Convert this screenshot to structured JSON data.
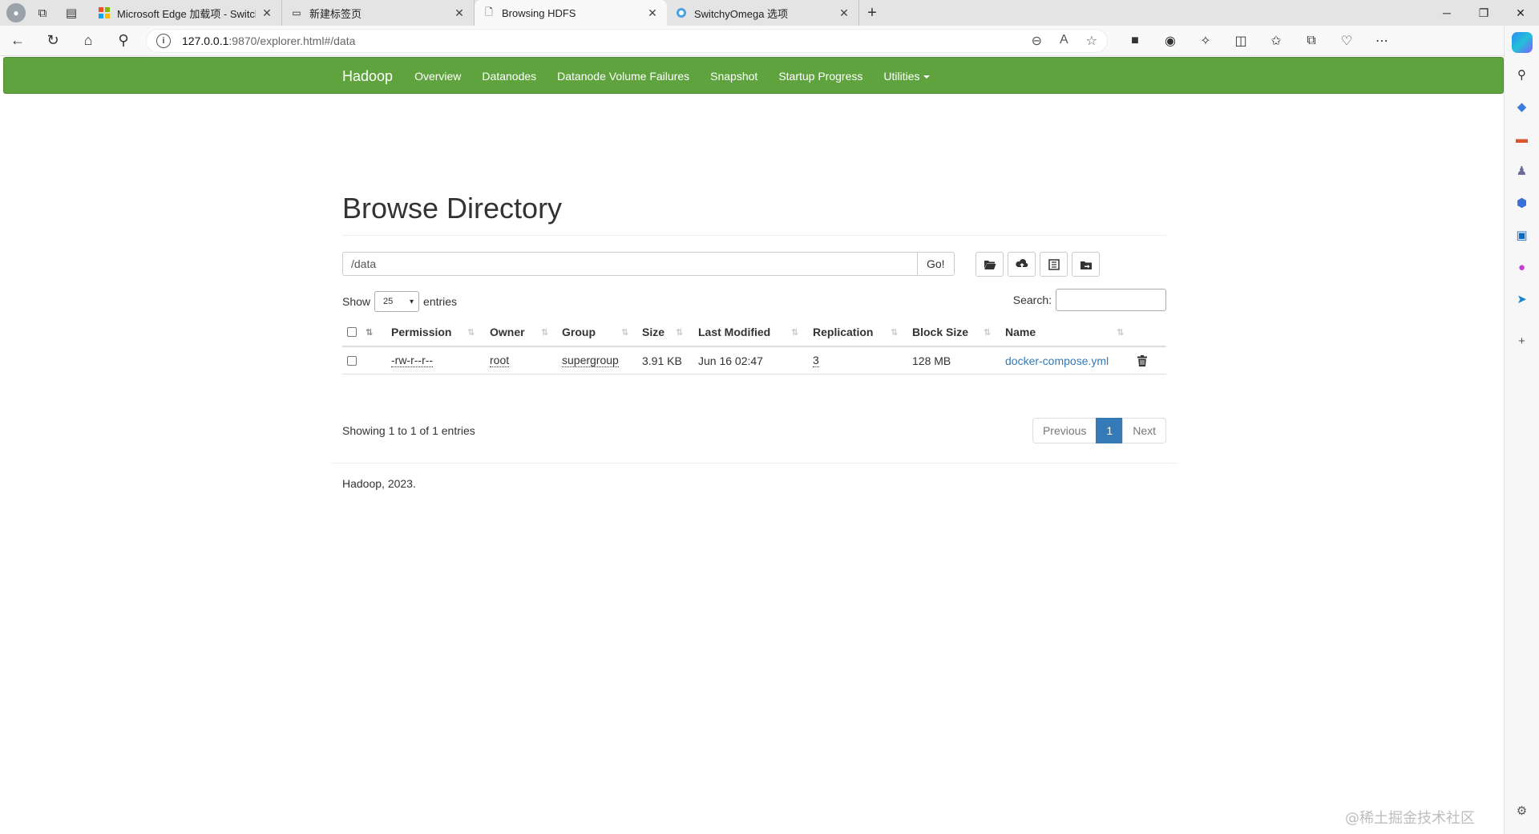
{
  "browser": {
    "tabs": [
      {
        "title": "Microsoft Edge 加载项 - SwitchyOmega",
        "favicon": "microsoft-logo-icon"
      },
      {
        "title": "新建标签页",
        "favicon": "newtab-icon"
      },
      {
        "title": "Browsing HDFS",
        "favicon": "page-icon",
        "active": true
      },
      {
        "title": "SwitchyOmega 选项",
        "favicon": "switchyomega-icon"
      }
    ],
    "url_host": "127.0.0.1",
    "url_path": ":9870/explorer.html#/data"
  },
  "navbar": {
    "brand": "Hadoop",
    "links": [
      "Overview",
      "Datanodes",
      "Datanode Volume Failures",
      "Snapshot",
      "Startup Progress"
    ],
    "utilities": "Utilities",
    "color": "#5fa33e"
  },
  "page": {
    "title": "Browse Directory",
    "path_value": "/data",
    "go_label": "Go!",
    "show_label": "Show",
    "page_size": "25",
    "entries_label": "entries",
    "search_label": "Search:"
  },
  "table": {
    "headers": [
      "Permission",
      "Owner",
      "Group",
      "Size",
      "Last Modified",
      "Replication",
      "Block Size",
      "Name"
    ],
    "rows": [
      {
        "permission": "-rw-r--r--",
        "owner": "root",
        "group": "supergroup",
        "size": "3.91 KB",
        "last_modified": "Jun 16 02:47",
        "replication": "3",
        "block_size": "128 MB",
        "name": "docker-compose.yml"
      }
    ]
  },
  "pagination": {
    "info": "Showing 1 to 1 of 1 entries",
    "previous": "Previous",
    "current": "1",
    "next": "Next"
  },
  "footer": {
    "text": "Hadoop, 2023."
  },
  "watermark": "@稀土掘金技术社区"
}
